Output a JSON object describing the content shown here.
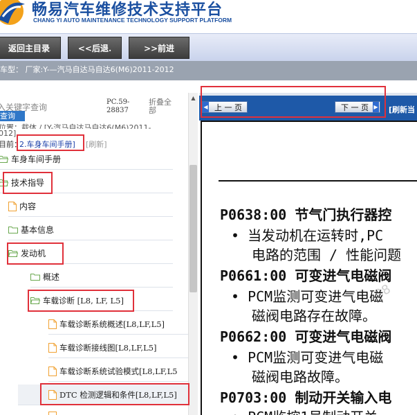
{
  "header": {
    "title": "畅易汽车维修技术支持平台",
    "subtitle": "CHANG YI AUTO MAINTENANCE TECHNOLOGY SUPPORT PLATFORM"
  },
  "nav": {
    "home": "返回主目录",
    "back": "<<后退.",
    "forward": ">>前进"
  },
  "vehicle": {
    "text": "车型：  厂家:Y-—汽马自达马自达6(M6)2011-2012"
  },
  "search": {
    "hint": "入关键字查询",
    "query_button": "查询",
    "pc_code_line1": "PC.59-",
    "pc_code_line2": "28837",
    "collapse_all": "折叠全部"
  },
  "breadcrumb": {
    "line1": "位置：载体 / [Y-汽马自达马自达6(M6)2011-",
    "line2": "012]",
    "current_label": "目前：",
    "current_value": "2.车身车间手册]",
    "refresh": "[刷新]"
  },
  "tree": [
    {
      "label": "车身车间手册",
      "kind": "folder-open"
    },
    {
      "label": "技术指导",
      "kind": "folder-open"
    },
    {
      "label": "内容",
      "kind": "doc"
    },
    {
      "label": "基本信息",
      "kind": "folder"
    },
    {
      "label": "发动机",
      "kind": "folder-open"
    },
    {
      "label": "概述",
      "kind": "folder"
    },
    {
      "label": "车载诊断 [L8, LF, L5]",
      "kind": "folder-open"
    },
    {
      "label": "车载诊断系统概述[L8,LF,L5]",
      "kind": "doc"
    },
    {
      "label": "车载诊断接线图[L8,LF,L5]",
      "kind": "doc"
    },
    {
      "label": "车载诊断系统试验模式[L8,LF,L5",
      "kind": "doc"
    },
    {
      "label": "DTC 检测逻辑和条件[L8,LF,L5]",
      "kind": "doc"
    }
  ],
  "pager": {
    "prev": "上 一 页",
    "next": "下 一 页",
    "refresh": "[刷新当"
  },
  "document": {
    "lines": [
      {
        "text": "P0638:00 节气门执行器控",
        "style": "code"
      },
      {
        "text": "• 当发动机在运转时,PC",
        "style": "bullet"
      },
      {
        "text": "电路的范围 / 性能问题",
        "style": "cont"
      },
      {
        "text": "P0661:00 可变进气电磁阀",
        "style": "code"
      },
      {
        "text": "• PCM监测可变进气电磁",
        "style": "bullet"
      },
      {
        "text": "磁阀电路存在故障。",
        "style": "cont"
      },
      {
        "text": "P0662:00 可变进气电磁阀",
        "style": "code"
      },
      {
        "text": "• PCM监测可变进气电磁",
        "style": "bullet"
      },
      {
        "text": "磁阀电路故障。",
        "style": "cont"
      },
      {
        "text": "P0703:00 制动开关输入电",
        "style": "code"
      },
      {
        "text": "• PCM监控1号制动开关",
        "style": "bullet"
      }
    ]
  },
  "colors": {
    "brand_blue": "#1a4fa0",
    "highlight_red": "#e0303a",
    "bar_blue": "#1e59a8"
  }
}
